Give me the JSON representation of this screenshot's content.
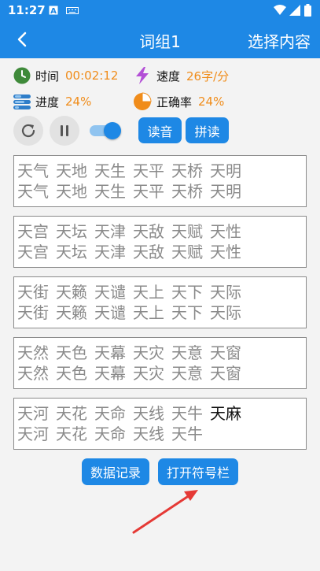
{
  "status_bar": {
    "time": "11:27"
  },
  "app_bar": {
    "title": "词组1",
    "right_action": "选择内容"
  },
  "stats": {
    "time_label": "时间",
    "time_value": "00:02:12",
    "speed_label": "速度",
    "speed_value": "26字/分",
    "progress_label": "进度",
    "progress_value": "24%",
    "accuracy_label": "正确率",
    "accuracy_value": "24%"
  },
  "controls": {
    "read_button": "读音",
    "pinyin_button": "拼读",
    "toggle_on": true
  },
  "cards": [
    {
      "target": [
        "天气",
        "天地",
        "天生",
        "天平",
        "天桥",
        "天明"
      ],
      "typed": [
        "天气",
        "天地",
        "天生",
        "天平",
        "天桥",
        "天明"
      ]
    },
    {
      "target": [
        "天宫",
        "天坛",
        "天津",
        "天敌",
        "天赋",
        "天性"
      ],
      "typed": [
        "天宫",
        "天坛",
        "天津",
        "天敌",
        "天赋",
        "天性"
      ]
    },
    {
      "target": [
        "天街",
        "天籁",
        "天谴",
        "天上",
        "天下",
        "天际"
      ],
      "typed": [
        "天街",
        "天籁",
        "天谴",
        "天上",
        "天下",
        "天际"
      ]
    },
    {
      "target": [
        "天然",
        "天色",
        "天幕",
        "天灾",
        "天意",
        "天窗"
      ],
      "typed": [
        "天然",
        "天色",
        "天幕",
        "天灾",
        "天意",
        "天窗"
      ]
    },
    {
      "target": [
        "天河",
        "天花",
        "天命",
        "天线",
        "天牛",
        "天麻"
      ],
      "typed": [
        "天河",
        "天花",
        "天命",
        "天线",
        "天牛"
      ],
      "current_index": 5
    }
  ],
  "bottom": {
    "record_button": "数据记录",
    "symbol_button": "打开符号栏"
  },
  "colors": {
    "primary": "#1e88e5",
    "value_orange": "#f08c1a",
    "pending_text": "#8a8a8a",
    "arrow_red": "#e53935"
  }
}
